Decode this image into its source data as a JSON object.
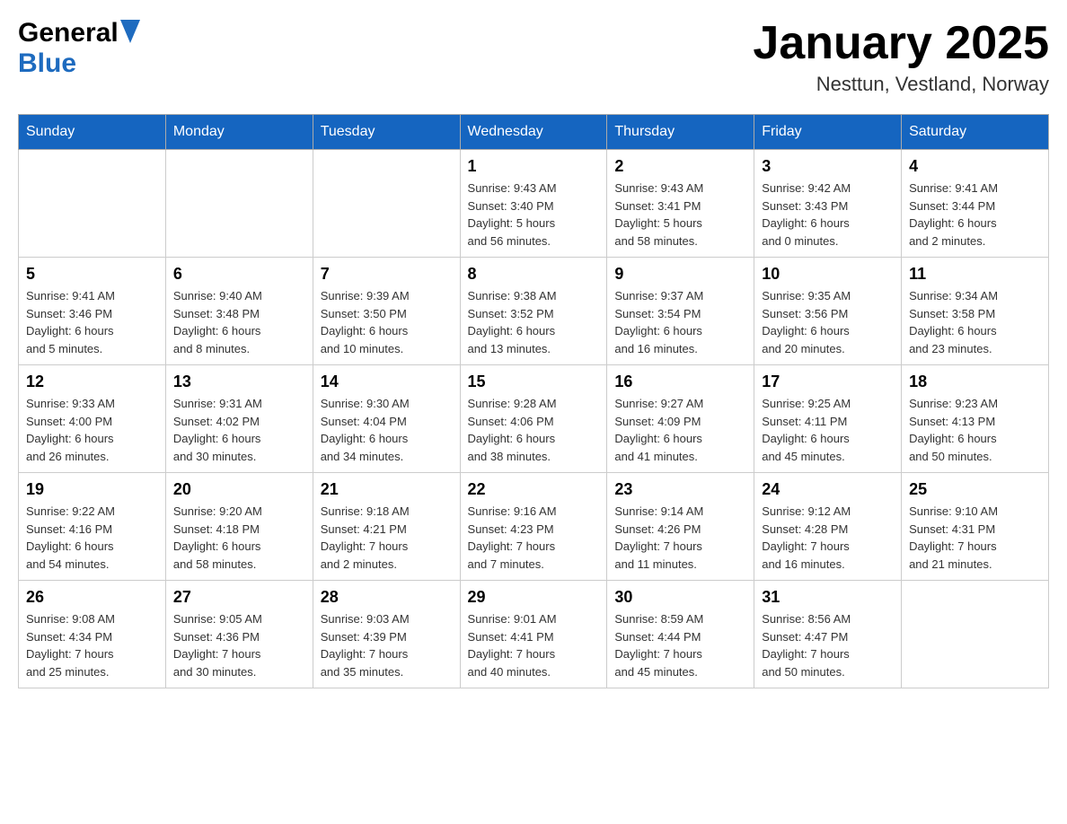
{
  "header": {
    "logo_general": "General",
    "logo_blue": "Blue",
    "title": "January 2025",
    "subtitle": "Nesttun, Vestland, Norway"
  },
  "weekdays": [
    "Sunday",
    "Monday",
    "Tuesday",
    "Wednesday",
    "Thursday",
    "Friday",
    "Saturday"
  ],
  "weeks": [
    [
      {
        "day": "",
        "info": ""
      },
      {
        "day": "",
        "info": ""
      },
      {
        "day": "",
        "info": ""
      },
      {
        "day": "1",
        "info": "Sunrise: 9:43 AM\nSunset: 3:40 PM\nDaylight: 5 hours\nand 56 minutes."
      },
      {
        "day": "2",
        "info": "Sunrise: 9:43 AM\nSunset: 3:41 PM\nDaylight: 5 hours\nand 58 minutes."
      },
      {
        "day": "3",
        "info": "Sunrise: 9:42 AM\nSunset: 3:43 PM\nDaylight: 6 hours\nand 0 minutes."
      },
      {
        "day": "4",
        "info": "Sunrise: 9:41 AM\nSunset: 3:44 PM\nDaylight: 6 hours\nand 2 minutes."
      }
    ],
    [
      {
        "day": "5",
        "info": "Sunrise: 9:41 AM\nSunset: 3:46 PM\nDaylight: 6 hours\nand 5 minutes."
      },
      {
        "day": "6",
        "info": "Sunrise: 9:40 AM\nSunset: 3:48 PM\nDaylight: 6 hours\nand 8 minutes."
      },
      {
        "day": "7",
        "info": "Sunrise: 9:39 AM\nSunset: 3:50 PM\nDaylight: 6 hours\nand 10 minutes."
      },
      {
        "day": "8",
        "info": "Sunrise: 9:38 AM\nSunset: 3:52 PM\nDaylight: 6 hours\nand 13 minutes."
      },
      {
        "day": "9",
        "info": "Sunrise: 9:37 AM\nSunset: 3:54 PM\nDaylight: 6 hours\nand 16 minutes."
      },
      {
        "day": "10",
        "info": "Sunrise: 9:35 AM\nSunset: 3:56 PM\nDaylight: 6 hours\nand 20 minutes."
      },
      {
        "day": "11",
        "info": "Sunrise: 9:34 AM\nSunset: 3:58 PM\nDaylight: 6 hours\nand 23 minutes."
      }
    ],
    [
      {
        "day": "12",
        "info": "Sunrise: 9:33 AM\nSunset: 4:00 PM\nDaylight: 6 hours\nand 26 minutes."
      },
      {
        "day": "13",
        "info": "Sunrise: 9:31 AM\nSunset: 4:02 PM\nDaylight: 6 hours\nand 30 minutes."
      },
      {
        "day": "14",
        "info": "Sunrise: 9:30 AM\nSunset: 4:04 PM\nDaylight: 6 hours\nand 34 minutes."
      },
      {
        "day": "15",
        "info": "Sunrise: 9:28 AM\nSunset: 4:06 PM\nDaylight: 6 hours\nand 38 minutes."
      },
      {
        "day": "16",
        "info": "Sunrise: 9:27 AM\nSunset: 4:09 PM\nDaylight: 6 hours\nand 41 minutes."
      },
      {
        "day": "17",
        "info": "Sunrise: 9:25 AM\nSunset: 4:11 PM\nDaylight: 6 hours\nand 45 minutes."
      },
      {
        "day": "18",
        "info": "Sunrise: 9:23 AM\nSunset: 4:13 PM\nDaylight: 6 hours\nand 50 minutes."
      }
    ],
    [
      {
        "day": "19",
        "info": "Sunrise: 9:22 AM\nSunset: 4:16 PM\nDaylight: 6 hours\nand 54 minutes."
      },
      {
        "day": "20",
        "info": "Sunrise: 9:20 AM\nSunset: 4:18 PM\nDaylight: 6 hours\nand 58 minutes."
      },
      {
        "day": "21",
        "info": "Sunrise: 9:18 AM\nSunset: 4:21 PM\nDaylight: 7 hours\nand 2 minutes."
      },
      {
        "day": "22",
        "info": "Sunrise: 9:16 AM\nSunset: 4:23 PM\nDaylight: 7 hours\nand 7 minutes."
      },
      {
        "day": "23",
        "info": "Sunrise: 9:14 AM\nSunset: 4:26 PM\nDaylight: 7 hours\nand 11 minutes."
      },
      {
        "day": "24",
        "info": "Sunrise: 9:12 AM\nSunset: 4:28 PM\nDaylight: 7 hours\nand 16 minutes."
      },
      {
        "day": "25",
        "info": "Sunrise: 9:10 AM\nSunset: 4:31 PM\nDaylight: 7 hours\nand 21 minutes."
      }
    ],
    [
      {
        "day": "26",
        "info": "Sunrise: 9:08 AM\nSunset: 4:34 PM\nDaylight: 7 hours\nand 25 minutes."
      },
      {
        "day": "27",
        "info": "Sunrise: 9:05 AM\nSunset: 4:36 PM\nDaylight: 7 hours\nand 30 minutes."
      },
      {
        "day": "28",
        "info": "Sunrise: 9:03 AM\nSunset: 4:39 PM\nDaylight: 7 hours\nand 35 minutes."
      },
      {
        "day": "29",
        "info": "Sunrise: 9:01 AM\nSunset: 4:41 PM\nDaylight: 7 hours\nand 40 minutes."
      },
      {
        "day": "30",
        "info": "Sunrise: 8:59 AM\nSunset: 4:44 PM\nDaylight: 7 hours\nand 45 minutes."
      },
      {
        "day": "31",
        "info": "Sunrise: 8:56 AM\nSunset: 4:47 PM\nDaylight: 7 hours\nand 50 minutes."
      },
      {
        "day": "",
        "info": ""
      }
    ]
  ]
}
